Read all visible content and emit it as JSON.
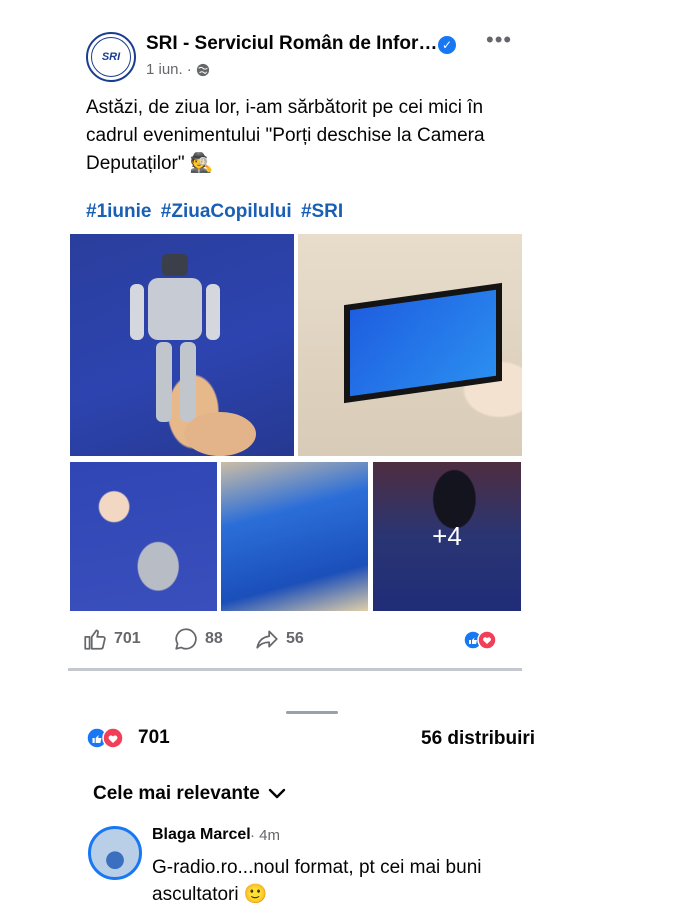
{
  "post": {
    "page_name": "SRI - Serviciul Român de Infor…",
    "avatar_text": "SRI",
    "date": "1 iun.",
    "separator": "·",
    "text": "Astăzi, de ziua lor, i-am sărbătorit pe cei mici în cadrul evenimentului \"Porți deschise la Camera Deputaților\" 🕵️",
    "hashtags": [
      "#1iunie",
      "#ZiuaCopilului",
      "#SRI"
    ],
    "more_photos": "+4"
  },
  "actions": {
    "likes": "701",
    "comments": "88",
    "shares": "56"
  },
  "summary": {
    "reactions_count": "701",
    "shares_label": "56 distribuiri"
  },
  "comments_section": {
    "sort_label": "Cele mai relevante",
    "comments": [
      {
        "author": "Blaga Marcel",
        "time": "· 4m",
        "text": "G-radio.ro...noul format, pt cei mai buni ascultatori 🙂"
      }
    ]
  },
  "colors": {
    "accent": "#1877f2",
    "hashtag": "#1a5fb4",
    "love": "#f33e58"
  }
}
